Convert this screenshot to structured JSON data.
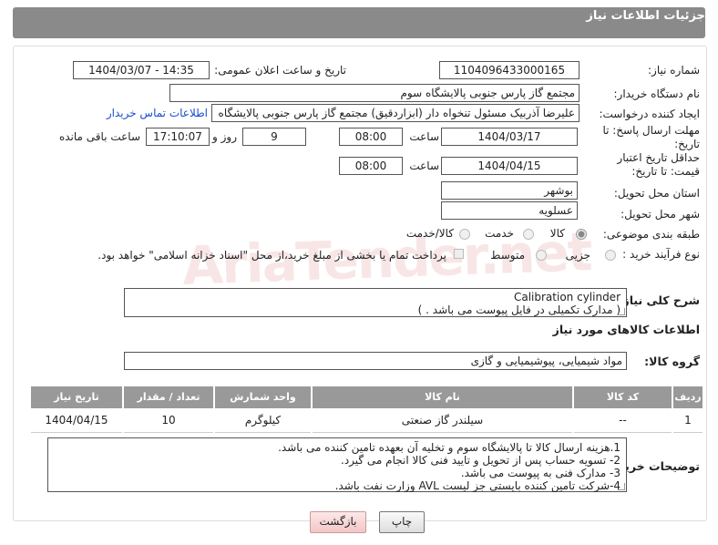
{
  "header": {
    "title": "جزئیات اطلاعات نیاز"
  },
  "labels": {
    "need_number": "شماره نیاز:",
    "announce_datetime": "تاریخ و ساعت اعلان عمومی:",
    "buyer_org": "نام دستگاه خریدار:",
    "request_creator": "ایجاد کننده درخواست:",
    "response_deadline": "مهلت ارسال پاسخ: تا تاریخ:",
    "price_validity": "حداقل تاریخ اعتبار قیمت: تا تاریخ:",
    "delivery_province": "استان محل تحویل:",
    "delivery_city": "شهر محل تحویل:",
    "category": "طبقه بندی موضوعی:",
    "purchase_type": "نوع فرآیند خرید :",
    "time": "ساعت",
    "time2": "ساعت",
    "days": "روز و",
    "remaining": "ساعت باقی مانده",
    "description": "شرح کلی نیاز:",
    "goods_info": "اطلاعات کالاهای مورد نیاز",
    "goods_group": "گروه کالا:",
    "buyer_notes": "توضیحات خریدار:"
  },
  "fields": {
    "need_number": "1104096433000165",
    "announce_datetime": "1404/03/07 - 14:35",
    "buyer_org": "مجتمع گاز پارس جنوبی  پالایشگاه سوم",
    "request_creator": "علیرضا آذربیک مسئول تنخواه دار  (ابزاردقیق) مجتمع گاز پارس جنوبی  پالایشگاه",
    "contact_link": "اطلاعات تماس خریدار",
    "response_date": "1404/03/17",
    "response_time": "08:00",
    "response_days": "9",
    "remaining_time": "17:10:07",
    "validity_date": "1404/04/15",
    "validity_time": "08:00",
    "province": "بوشهر",
    "city": "عسلویه"
  },
  "category_options": [
    {
      "label": "کالا",
      "selected": true
    },
    {
      "label": "خدمت",
      "selected": false
    },
    {
      "label": "کالا/خدمت",
      "selected": false
    }
  ],
  "purchase_options": [
    {
      "label": "جزیی",
      "selected": false
    },
    {
      "label": "متوسط",
      "selected": false
    }
  ],
  "payment_note": "پرداخت تمام یا بخشی از مبلغ خرید،از محل \"اسناد خزانه اسلامی\" خواهد بود.",
  "description_lines": [
    "Calibration cylinder",
    "( مدارک تکمیلی در فایل پیوست می باشد . )"
  ],
  "goods_group_value": "مواد شیمیایی، پیوشیمیایی و  گازی",
  "table": {
    "headers": [
      "ردیف",
      "کد کالا",
      "نام کالا",
      "واحد شمارش",
      "تعداد / مقدار",
      "تاریخ نیاز"
    ],
    "rows": [
      [
        "1",
        "--",
        "سیلندر گاز صنعتی",
        "کیلوگرم",
        "10",
        "1404/04/15"
      ]
    ]
  },
  "buyer_notes_lines": [
    "1.هزینه ارسال کالا تا پالایشگاه سوم و تخلیه آن بعهده تامین کننده می باشد.",
    "2- تسویه حساب پس از تحویل و تایید فنی کالا انجام می گیرد.",
    "3- مدارک فنی به پیوست می باشد.",
    "4-شرکت تامین کننده بایستی جز لیست AVL وزارت نفت باشد."
  ],
  "buttons": {
    "print": "چاپ",
    "back": "بازگشت"
  },
  "watermark": "AriaTender.net"
}
